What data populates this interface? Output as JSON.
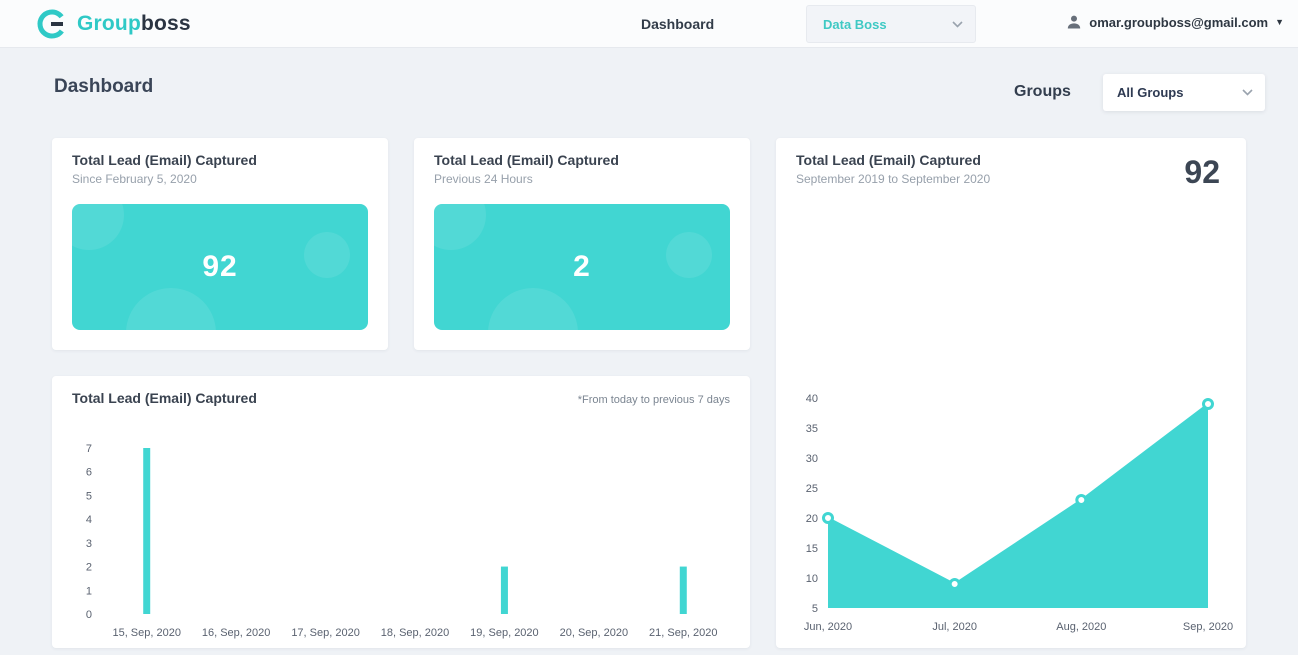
{
  "header": {
    "logo": {
      "primary": "Group",
      "secondary": "boss"
    },
    "nav": {
      "dashboard": "Dashboard"
    },
    "workspace_select": {
      "value": "Data Boss"
    },
    "user": {
      "email": "omar.groupboss@gmail.com"
    }
  },
  "page": {
    "title": "Dashboard",
    "groups_label": "Groups",
    "groups_select": {
      "value": "All Groups"
    }
  },
  "cards": {
    "total_since": {
      "title": "Total Lead (Email) Captured",
      "subtitle": "Since February 5, 2020",
      "value": "92"
    },
    "total_24h": {
      "title": "Total Lead (Email) Captured",
      "subtitle": "Previous 24 Hours",
      "value": "2"
    },
    "yearly": {
      "total": "92"
    }
  },
  "icons": {
    "user": "person-icon",
    "chevron": "chevron-down-icon",
    "logo": "groupboss-logo"
  },
  "colors": {
    "accent": "#41d6d2",
    "dark_text": "#3a4350",
    "muted_text": "#97a0ab"
  },
  "chart_data": [
    {
      "type": "bar",
      "title": "Total Lead (Email) Captured",
      "note": "*From today to previous 7 days",
      "categories": [
        "15, Sep, 2020",
        "16, Sep, 2020",
        "17, Sep, 2020",
        "18, Sep, 2020",
        "19, Sep, 2020",
        "20, Sep, 2020",
        "21, Sep, 2020"
      ],
      "values": [
        7,
        0,
        0,
        0,
        2,
        0,
        2
      ],
      "xlabel": "",
      "ylabel": "",
      "ylim": [
        0,
        7
      ],
      "yticks": [
        0,
        1,
        2,
        3,
        4,
        5,
        6,
        7
      ],
      "grid": false,
      "legend": false
    },
    {
      "type": "area",
      "title": "Total Lead (Email) Captured",
      "subtitle": "September 2019 to September 2020",
      "x": [
        "Jun, 2020",
        "Jul, 2020",
        "Aug, 2020",
        "Sep, 2020"
      ],
      "values": [
        20,
        9,
        23,
        39
      ],
      "xlabel": "",
      "ylabel": "",
      "ylim": [
        5,
        40
      ],
      "yticks": [
        5,
        10,
        15,
        20,
        25,
        30,
        35,
        40
      ],
      "grid": false,
      "legend": false
    }
  ]
}
